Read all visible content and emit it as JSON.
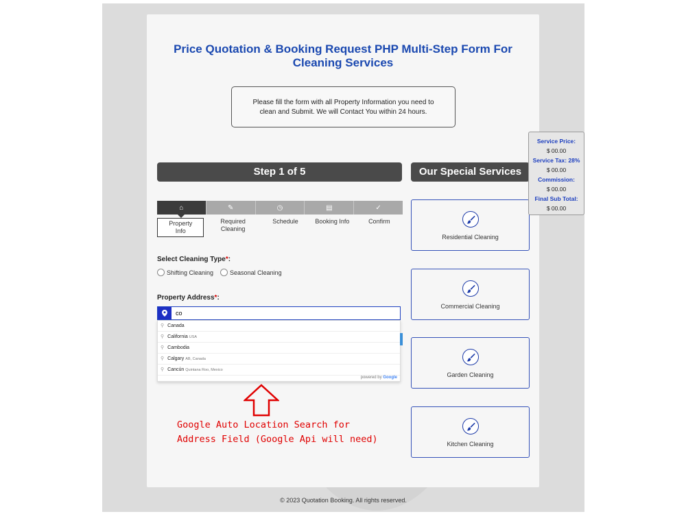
{
  "form": {
    "title_line1": "Price Quotation & Booking Request PHP Multi-Step Form For",
    "title_line2": "Cleaning Services",
    "notice_line1": "Please fill the form with all Property Information you need to",
    "notice_line2": "clean and Submit. We will Contact You within 24 hours.",
    "step_header": "Step 1 of 5",
    "steps": [
      {
        "label": "Property Info",
        "icon": "home-icon",
        "glyph": "⌂"
      },
      {
        "label": "Required Cleaning",
        "icon": "brush-icon",
        "glyph": "✎"
      },
      {
        "label": "Schedule",
        "icon": "clock-icon",
        "glyph": "◷"
      },
      {
        "label": "Booking Info",
        "icon": "id-card-icon",
        "glyph": "▤"
      },
      {
        "label": "Confirm",
        "icon": "check-icon",
        "glyph": "✓"
      }
    ],
    "cleaning_type_label": "Select Cleaning Type",
    "required_mark": "*",
    "colon": ":",
    "radio_options": [
      "Shifting Cleaning",
      "Seasonal Cleaning"
    ],
    "address_label": "Property Address",
    "address_value": "co",
    "address_icon": "map-marker-icon",
    "suggestions": [
      {
        "main": "Canada",
        "secondary": ""
      },
      {
        "main": "California",
        "secondary": "USA"
      },
      {
        "main": "Cambodia",
        "secondary": ""
      },
      {
        "main": "Calgary",
        "secondary": "AB, Canada"
      },
      {
        "main": "Cancún",
        "secondary": "Quintana Roo, Mexico"
      }
    ],
    "powered_by_text": "powered by",
    "powered_by_brand": "Google"
  },
  "annotation": {
    "line1": "Google Auto Location Search for",
    "line2": "Address Field (Google Api will need)"
  },
  "services": {
    "header": "Our Special Services",
    "items": [
      {
        "name": "Residential Cleaning",
        "icon": "brush-icon"
      },
      {
        "name": "Commercial Cleaning",
        "icon": "brush-icon"
      },
      {
        "name": "Garden Cleaning",
        "icon": "brush-icon"
      },
      {
        "name": "Kitchen Cleaning",
        "icon": "brush-icon"
      }
    ]
  },
  "price_panel": {
    "service_price_label": "Service Price:",
    "service_price_value": "$ 00.00",
    "service_tax_label": "Service Tax: 28%",
    "service_tax_value": "$ 00.00",
    "commission_label": "Commission:",
    "commission_value": "$ 00.00",
    "final_label": "Final Sub Total:",
    "final_value": "$ 00.00"
  },
  "footer": {
    "text": "© 2023 Quotation Booking. All rights reserved."
  },
  "colors": {
    "accent": "#1a48b0",
    "dark_bar": "#4a4a4a",
    "annotation": "#e00000"
  }
}
